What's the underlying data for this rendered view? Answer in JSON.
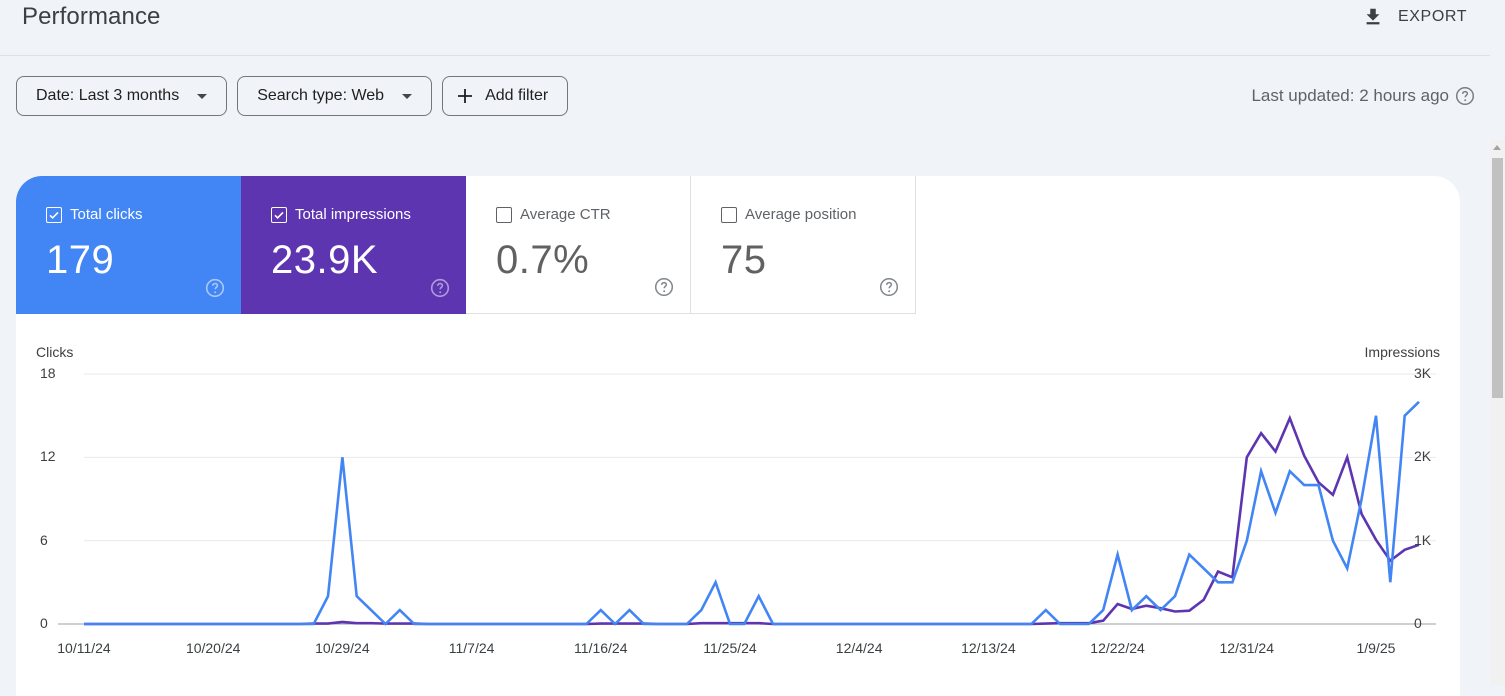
{
  "header": {
    "title": "Performance",
    "export_label": "EXPORT",
    "export_icon": "download-icon"
  },
  "filters": {
    "date_label": "Date: Last 3 months",
    "search_type_label": "Search type: Web",
    "add_filter_label": "Add filter"
  },
  "last_updated": "Last updated: 2 hours ago",
  "metrics": [
    {
      "label": "Total clicks",
      "value": "179",
      "checked": true,
      "color": "#4285f4"
    },
    {
      "label": "Total impressions",
      "value": "23.9K",
      "checked": true,
      "color": "#5e35b1"
    },
    {
      "label": "Average CTR",
      "value": "0.7%",
      "checked": false
    },
    {
      "label": "Average position",
      "value": "75",
      "checked": false
    }
  ],
  "chart_data": {
    "type": "line",
    "title": "",
    "xlabel": "",
    "start_date": "10/11/24",
    "x_tick_labels": [
      "10/11/24",
      "10/20/24",
      "10/29/24",
      "11/7/24",
      "11/16/24",
      "11/25/24",
      "12/4/24",
      "12/13/24",
      "12/22/24",
      "12/31/24",
      "1/9/25"
    ],
    "x_tick_every_days": 9,
    "grid": true,
    "legend": "none",
    "y_left": {
      "label": "Clicks",
      "ticks": [
        "0",
        "6",
        "12",
        "18"
      ],
      "range": [
        0,
        18
      ]
    },
    "y_right": {
      "label": "Impressions",
      "ticks": [
        "0",
        "1K",
        "2K",
        "3K"
      ],
      "range": [
        0,
        3000
      ]
    },
    "series": [
      {
        "name": "Clicks",
        "axis": "left",
        "color": "#4285f4",
        "values": [
          0,
          0,
          0,
          0,
          0,
          0,
          0,
          0,
          0,
          0,
          0,
          0,
          0,
          0,
          0,
          0,
          0,
          2,
          12,
          2,
          1,
          0,
          1,
          0,
          0,
          0,
          0,
          0,
          0,
          0,
          0,
          0,
          0,
          0,
          0,
          0,
          1,
          0,
          1,
          0,
          0,
          0,
          0,
          1,
          3,
          0,
          0,
          2,
          0,
          0,
          0,
          0,
          0,
          0,
          0,
          0,
          0,
          0,
          0,
          0,
          0,
          0,
          0,
          0,
          0,
          0,
          0,
          1,
          0,
          0,
          0,
          1,
          5,
          1,
          2,
          1,
          2,
          5,
          4,
          3,
          3,
          6,
          11,
          8,
          11,
          10,
          10,
          6,
          4,
          9,
          15,
          3,
          15,
          16
        ]
      },
      {
        "name": "Impressions",
        "axis": "right",
        "color": "#5e35b1",
        "values": [
          0,
          0,
          0,
          0,
          0,
          0,
          0,
          0,
          0,
          0,
          0,
          0,
          0,
          0,
          0,
          0,
          5,
          5,
          25,
          10,
          10,
          5,
          5,
          5,
          0,
          0,
          0,
          0,
          0,
          0,
          0,
          0,
          0,
          0,
          0,
          0,
          5,
          5,
          5,
          5,
          0,
          0,
          0,
          10,
          10,
          10,
          10,
          10,
          0,
          0,
          0,
          0,
          0,
          0,
          0,
          0,
          0,
          0,
          0,
          0,
          0,
          0,
          0,
          0,
          0,
          0,
          0,
          5,
          10,
          10,
          10,
          40,
          240,
          180,
          220,
          190,
          150,
          160,
          290,
          630,
          560,
          2000,
          2290,
          2070,
          2470,
          2020,
          1700,
          1550,
          2000,
          1320,
          1010,
          760,
          890,
          950
        ]
      }
    ]
  }
}
